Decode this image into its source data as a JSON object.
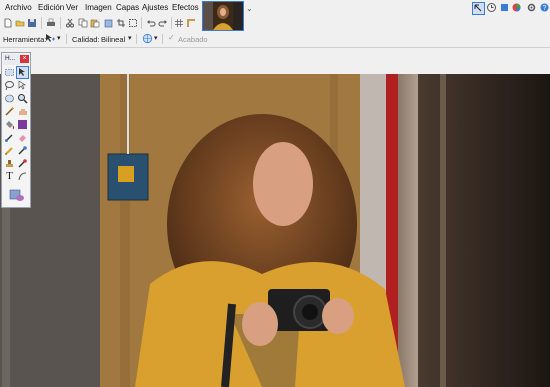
{
  "menu": {
    "items": [
      "Archivo",
      "Edición",
      "Ver",
      "Imagen",
      "Capas",
      "Ajustes",
      "Efectos"
    ]
  },
  "options_bar": {
    "tool_label": "Herramienta:",
    "quality_label": "Calidad:",
    "quality_value": "Bilineal",
    "finish_label": "Acabado"
  },
  "tools_window": {
    "title": "H..."
  },
  "text_tool": {
    "glyph": "T"
  },
  "colors": {
    "accent": "#3a7bd5",
    "close_red": "#d9343b",
    "bg": "#f0f0f0",
    "jacket": "#d9a030"
  }
}
